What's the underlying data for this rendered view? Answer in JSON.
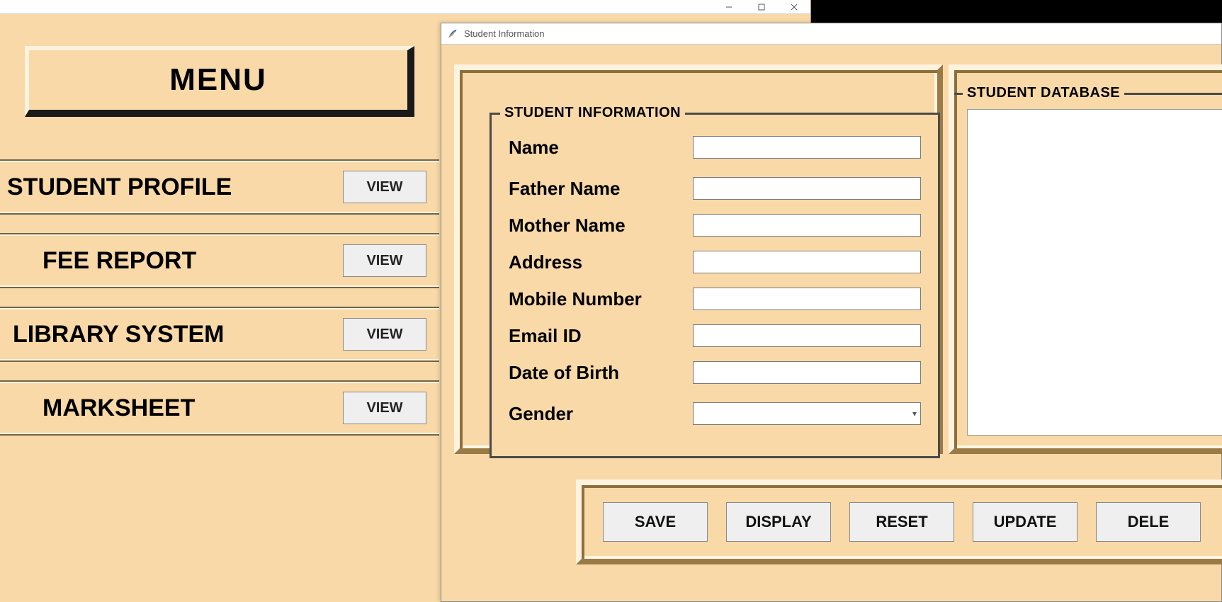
{
  "parent_window": {
    "titlebar_buttons": {
      "minimize": "minimize",
      "maximize": "maximize",
      "close": "close"
    },
    "menu_header": "MENU",
    "items": [
      {
        "label": "STUDENT PROFILE",
        "button": "VIEW"
      },
      {
        "label": "FEE REPORT",
        "button": "VIEW"
      },
      {
        "label": "LIBRARY SYSTEM",
        "button": "VIEW"
      },
      {
        "label": "MARKSHEET",
        "button": "VIEW"
      }
    ]
  },
  "child_window": {
    "title": "Student Information",
    "info_frame_legend": "STUDENT INFORMATION",
    "database_frame_legend": "STUDENT DATABASE",
    "fields": {
      "name": {
        "label": "Name",
        "value": ""
      },
      "father_name": {
        "label": "Father Name",
        "value": ""
      },
      "mother_name": {
        "label": "Mother Name",
        "value": ""
      },
      "address": {
        "label": "Address",
        "value": ""
      },
      "mobile": {
        "label": "Mobile Number",
        "value": ""
      },
      "email": {
        "label": "Email ID",
        "value": ""
      },
      "dob": {
        "label": "Date of Birth",
        "value": ""
      },
      "gender": {
        "label": "Gender",
        "value": ""
      }
    },
    "buttons": {
      "save": "SAVE",
      "display": "DISPLAY",
      "reset": "RESET",
      "update": "UPDATE",
      "delete": "DELE"
    }
  },
  "colors": {
    "bg": "#f8d9a7",
    "ridge_light": "#fff3df",
    "ridge_dark": "#9b7b45"
  }
}
